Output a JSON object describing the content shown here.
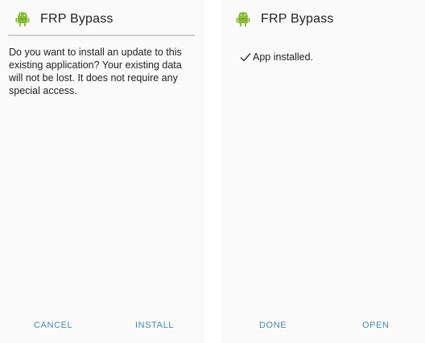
{
  "left_screen": {
    "app_title": "FRP Bypass",
    "app_icon": "android-robot-icon",
    "message": "Do you want to install an update to this existing application? Your existing data will not be lost. It does not require any special access.",
    "cancel_label": "CANCEL",
    "install_label": "INSTALL"
  },
  "right_screen": {
    "app_title": "FRP Bypass",
    "app_icon": "android-robot-icon",
    "status_text": "App installed.",
    "done_label": "DONE",
    "open_label": "OPEN"
  },
  "colors": {
    "accent": "#4a8aa8",
    "icon_green": "#8bbd3c",
    "background": "#fafafa"
  }
}
